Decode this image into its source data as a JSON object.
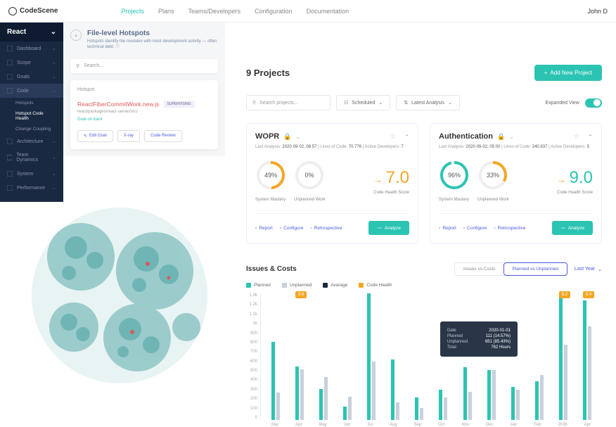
{
  "brand": "CodeScene",
  "nav": {
    "links": [
      "Projects",
      "Plans",
      "Teams/Developers",
      "Configuration",
      "Documentation"
    ],
    "active": 0,
    "user": "John D"
  },
  "sidebar": {
    "title": "React",
    "items": [
      {
        "label": "Dashboard"
      },
      {
        "label": "Scope"
      },
      {
        "label": "Goals"
      },
      {
        "label": "Code",
        "active": true,
        "subs": [
          "Hotspots",
          "Hotspot Code Health",
          "Change Coupling"
        ],
        "active_sub": 1
      },
      {
        "label": "Architecture"
      },
      {
        "label": "Team Dynamics"
      },
      {
        "label": "System"
      },
      {
        "label": "Performance"
      }
    ]
  },
  "hotspot": {
    "title": "File-level Hotspots",
    "sub": "Hotspots identify the modules with most development activity — often technical debt.",
    "search_ph": "Search...",
    "label": "Hotspot",
    "file": "ReactFiberCommitWork.new.js",
    "badge": "SUPERVISING",
    "path": "react/packages/react-server/src/",
    "goal": "Goal on track",
    "actions": [
      "Edit Goal",
      "X-ray",
      "Code Review"
    ]
  },
  "projects": {
    "title": "9 Projects",
    "add": "Add New Project",
    "search_ph": "Search projects...",
    "dd1": "Scheduled",
    "dd2": "Latest Analysis",
    "expanded": "Expanded View",
    "cards": [
      {
        "name": "WOPR",
        "meta": "Last Analysis: 2020-09-02, 06:57 | Lines of Code: 70.776 | Active Developers: 7",
        "mastery": 49,
        "unplanned": 0,
        "score": "7.0",
        "color": "orange"
      },
      {
        "name": "Authentication",
        "meta": "Last Analysis: 2020-09-02, 05:00 | Lines of Code: 240.937 | Active Developers: 5",
        "mastery": 96,
        "unplanned": 33,
        "score": "9.0",
        "color": "teal"
      }
    ],
    "labels": {
      "mastery": "System Mastery",
      "unplanned": "Unplanned Work",
      "score": "Code Health Score"
    },
    "footer": [
      "Report",
      "Configure",
      "Retrospective"
    ],
    "analyze": "Analyze"
  },
  "chart_data": {
    "type": "bar",
    "title": "Issues & Costs",
    "segments": [
      "Issues vs Costs",
      "Planned vs Unplanned"
    ],
    "active_segment": 1,
    "period": "Last Year",
    "legend": [
      {
        "name": "Planned",
        "color": "#2bc4b3"
      },
      {
        "name": "Unplanned",
        "color": "#c8d0dc"
      },
      {
        "name": "Avarage",
        "color": "#1a2942"
      },
      {
        "name": "Code Health",
        "color": "#f5a623"
      }
    ],
    "ylim": [
      0,
      1300
    ],
    "yticks": [
      "1.3k",
      "1.2k",
      "1.1k",
      "1k",
      "900",
      "800",
      "700",
      "600",
      "500",
      "400",
      "300",
      "200",
      "100",
      "0"
    ],
    "categories": [
      "Mar",
      "Apr",
      "May",
      "Jun",
      "Jul",
      "Aug",
      "Sep",
      "Oct",
      "Nov",
      "Dec",
      "Jan",
      "Feb",
      "2036",
      "Apr"
    ],
    "series": [
      {
        "name": "Planned",
        "values": [
          800,
          550,
          320,
          140,
          1300,
          620,
          230,
          310,
          540,
          510,
          340,
          400,
          1270,
          1230
        ]
      },
      {
        "name": "Unplanned",
        "values": [
          280,
          520,
          440,
          240,
          600,
          180,
          120,
          230,
          290,
          510,
          310,
          460,
          770,
          960
        ]
      }
    ],
    "callouts": [
      {
        "i": 1,
        "v": "8.6"
      },
      {
        "i": 12,
        "v": "8.2"
      },
      {
        "i": 13,
        "v": "8.4"
      }
    ],
    "tooltip": {
      "Date": "2020-01-01",
      "Planned": "111 (14.57%)",
      "Unplanned": "651 (85.43%)",
      "Total": "762 Hours"
    }
  }
}
